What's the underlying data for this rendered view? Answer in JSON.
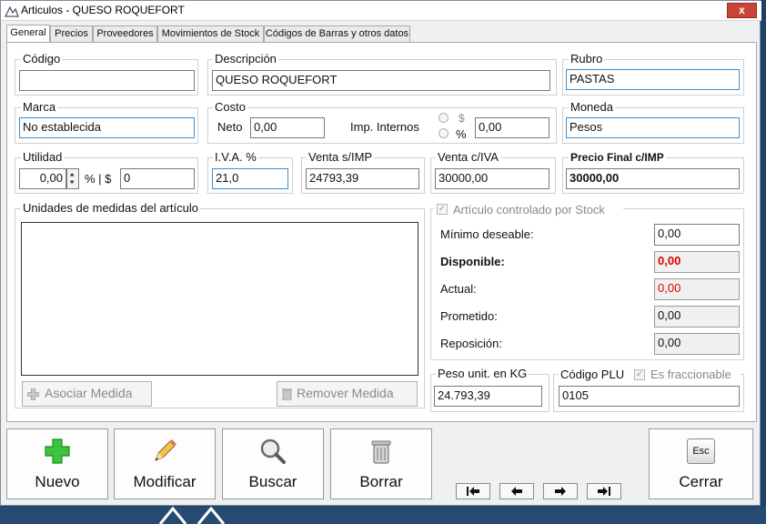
{
  "window": {
    "title": "Articulos - QUESO ROQUEFORT",
    "close_label": "x"
  },
  "tabs": [
    "General",
    "Precios",
    "Proveedores",
    "Movimientos de Stock",
    "Códigos de Barras y otros datos"
  ],
  "codigo": {
    "label": "Código",
    "value": ""
  },
  "descripcion": {
    "label": "Descripción",
    "value": "QUESO ROQUEFORT"
  },
  "rubro": {
    "label": "Rubro",
    "value": "PASTAS"
  },
  "marca": {
    "label": "Marca",
    "value": "No establecida"
  },
  "costo": {
    "label": "Costo",
    "neto_label": "Neto",
    "neto_value": "0,00",
    "imp_label": "Imp. Internos",
    "opt_peso": "$",
    "opt_pct": "%",
    "imp_value": "0,00"
  },
  "moneda": {
    "label": "Moneda",
    "value": "Pesos"
  },
  "utilidad": {
    "label": "Utilidad",
    "value": "0,00",
    "pct_sep": "% | $",
    "amount": "0"
  },
  "iva": {
    "label": "I.V.A. %",
    "value": "21,0"
  },
  "venta_simp": {
    "label": "Venta s/IMP",
    "value": "24793,39"
  },
  "venta_civa": {
    "label": "Venta c/IVA",
    "value": "30000,00"
  },
  "precio_final": {
    "label": "Precio Final c/IMP",
    "value": "30000,00"
  },
  "unidades": {
    "label": "Unidades de medidas del artículo",
    "asociar": "Asociar Medida",
    "remover": "Remover Medida"
  },
  "stock": {
    "label": "Artículo controlado por Stock",
    "minimo_label": "Mínimo deseable:",
    "minimo_value": "0,00",
    "disponible_label": "Disponible:",
    "disponible_value": "0,00",
    "actual_label": "Actual:",
    "actual_value": "0,00",
    "prometido_label": "Prometido:",
    "prometido_value": "0,00",
    "reposicion_label": "Reposición:",
    "reposicion_value": "0,00"
  },
  "peso": {
    "label": "Peso unit. en KG",
    "value": "24.793,39"
  },
  "plu": {
    "label": "Código PLU",
    "fraccionable": "Es fraccionable",
    "value": "0105"
  },
  "toolbar": {
    "nuevo": "Nuevo",
    "modificar": "Modificar",
    "buscar": "Buscar",
    "borrar": "Borrar",
    "cerrar": "Cerrar",
    "esc": "Esc"
  },
  "colors": {
    "accent": "#3a8fd0",
    "alert": "#e00000",
    "brand_green": "#3cc43c"
  }
}
